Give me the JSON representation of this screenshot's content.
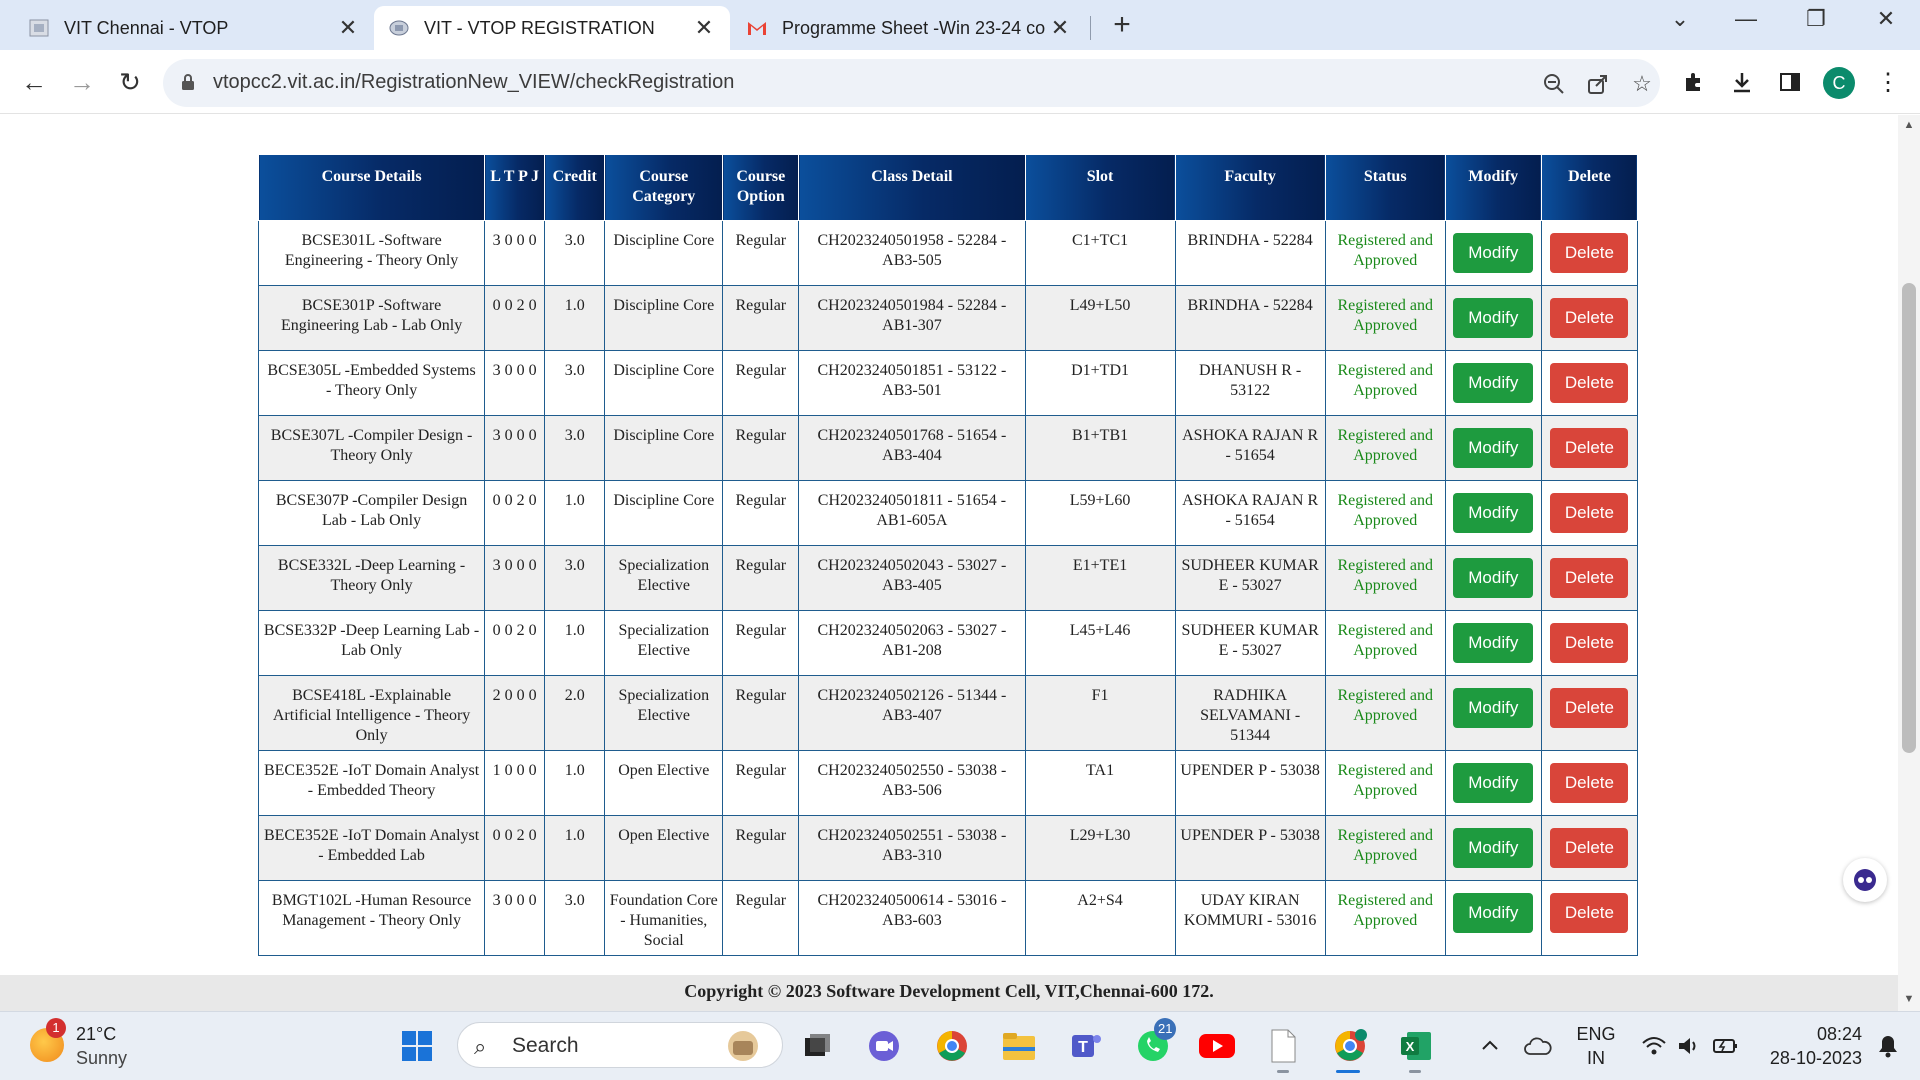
{
  "browser": {
    "tabs": [
      {
        "title": "VIT Chennai - VTOP",
        "active": false
      },
      {
        "title": "VIT - VTOP REGISTRATION",
        "active": true
      },
      {
        "title": "Programme Sheet -Win 23-24 co",
        "active": false
      }
    ],
    "url": "vtopcc2.vit.ac.in/RegistrationNew_VIEW/checkRegistration",
    "profile_initial": "C"
  },
  "table": {
    "headers": [
      "Course Details",
      "L T P J",
      "Credit",
      "Course Category",
      "Course Option",
      "Class Detail",
      "Slot",
      "Faculty",
      "Status",
      "Modify",
      "Delete"
    ],
    "modify_label": "Modify",
    "delete_label": "Delete",
    "rows": [
      {
        "course": "BCSE301L -Software Engineering - Theory Only",
        "ltpj": "3 0 0 0",
        "credit": "3.0",
        "category": "Discipline Core",
        "option": "Regular",
        "class_detail": "CH2023240501958 - 52284 - AB3-505",
        "slot": "C1+TC1",
        "faculty": "BRINDHA - 52284",
        "status": "Registered and Approved"
      },
      {
        "course": "BCSE301P -Software Engineering Lab - Lab Only",
        "ltpj": "0 0 2 0",
        "credit": "1.0",
        "category": "Discipline Core",
        "option": "Regular",
        "class_detail": "CH2023240501984 - 52284 - AB1-307",
        "slot": "L49+L50",
        "faculty": "BRINDHA - 52284",
        "status": "Registered and Approved"
      },
      {
        "course": "BCSE305L -Embedded Systems - Theory Only",
        "ltpj": "3 0 0 0",
        "credit": "3.0",
        "category": "Discipline Core",
        "option": "Regular",
        "class_detail": "CH2023240501851 - 53122 - AB3-501",
        "slot": "D1+TD1",
        "faculty": "DHANUSH R - 53122",
        "status": "Registered and Approved"
      },
      {
        "course": "BCSE307L -Compiler Design - Theory Only",
        "ltpj": "3 0 0 0",
        "credit": "3.0",
        "category": "Discipline Core",
        "option": "Regular",
        "class_detail": "CH2023240501768 - 51654 - AB3-404",
        "slot": "B1+TB1",
        "faculty": "ASHOKA RAJAN R - 51654",
        "status": "Registered and Approved"
      },
      {
        "course": "BCSE307P -Compiler Design Lab - Lab Only",
        "ltpj": "0 0 2 0",
        "credit": "1.0",
        "category": "Discipline Core",
        "option": "Regular",
        "class_detail": "CH2023240501811 - 51654 - AB1-605A",
        "slot": "L59+L60",
        "faculty": "ASHOKA RAJAN R - 51654",
        "status": "Registered and Approved"
      },
      {
        "course": "BCSE332L -Deep Learning - Theory Only",
        "ltpj": "3 0 0 0",
        "credit": "3.0",
        "category": "Specialization Elective",
        "option": "Regular",
        "class_detail": "CH2023240502043 - 53027 - AB3-405",
        "slot": "E1+TE1",
        "faculty": "SUDHEER KUMAR E - 53027",
        "status": "Registered and Approved"
      },
      {
        "course": "BCSE332P -Deep Learning Lab - Lab Only",
        "ltpj": "0 0 2 0",
        "credit": "1.0",
        "category": "Specialization Elective",
        "option": "Regular",
        "class_detail": "CH2023240502063 - 53027 - AB1-208",
        "slot": "L45+L46",
        "faculty": "SUDHEER KUMAR E - 53027",
        "status": "Registered and Approved"
      },
      {
        "course": "BCSE418L -Explainable Artificial Intelligence - Theory Only",
        "ltpj": "2 0 0 0",
        "credit": "2.0",
        "category": "Specialization Elective",
        "option": "Regular",
        "class_detail": "CH2023240502126 - 51344 - AB3-407",
        "slot": "F1",
        "faculty": "RADHIKA SELVAMANI - 51344",
        "status": "Registered and Approved"
      },
      {
        "course": "BECE352E -IoT Domain Analyst - Embedded Theory",
        "ltpj": "1 0 0 0",
        "credit": "1.0",
        "category": "Open Elective",
        "option": "Regular",
        "class_detail": "CH2023240502550 - 53038 - AB3-506",
        "slot": "TA1",
        "faculty": "UPENDER P - 53038",
        "status": "Registered and Approved"
      },
      {
        "course": "BECE352E -IoT Domain Analyst - Embedded Lab",
        "ltpj": "0 0 2 0",
        "credit": "1.0",
        "category": "Open Elective",
        "option": "Regular",
        "class_detail": "CH2023240502551 - 53038 - AB3-310",
        "slot": "L29+L30",
        "faculty": "UPENDER P - 53038",
        "status": "Registered and Approved"
      },
      {
        "course": "BMGT102L -Human Resource Management - Theory Only",
        "ltpj": "3 0 0 0",
        "credit": "3.0",
        "category": "Foundation Core - Humanities, Social",
        "option": "Regular",
        "class_detail": "CH2023240500614 - 53016 - AB3-603",
        "slot": "A2+S4",
        "faculty": "UDAY KIRAN KOMMURI - 53016",
        "status": "Registered and Approved"
      }
    ]
  },
  "footer": "Copyright © 2023 Software Development Cell, VIT,Chennai-600 172.",
  "taskbar": {
    "weather_badge": "1",
    "weather_temp": "21°C",
    "weather_cond": "Sunny",
    "search_label": "Search",
    "whatsapp_badge": "21",
    "lang_line1": "ENG",
    "lang_line2": "IN",
    "time": "08:24",
    "date": "28-10-2023"
  },
  "colors": {
    "header_start": "#0b4f9c",
    "header_end": "#041e4f",
    "modify_btn": "#1e9b3f",
    "delete_btn": "#d9453a",
    "status_text": "#1a8a1a"
  }
}
